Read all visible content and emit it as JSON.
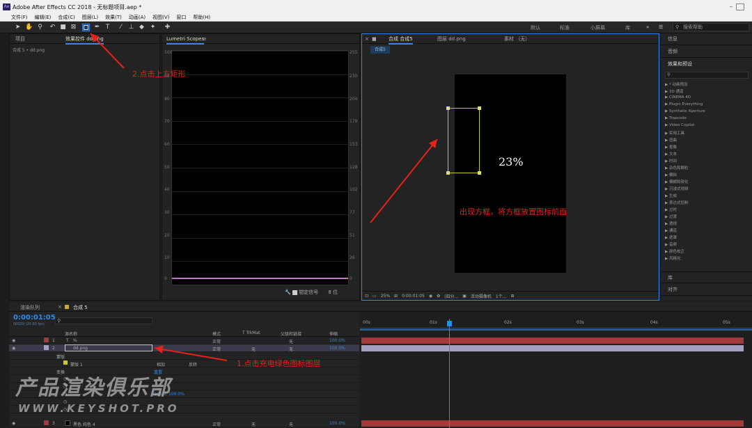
{
  "title": "Adobe After Effects CC 2018 - 无标题项目.aep *",
  "menu": [
    "文件(F)",
    "编辑(E)",
    "合成(C)",
    "图层(L)",
    "效果(T)",
    "动画(A)",
    "视图(V)",
    "窗口",
    "帮助(H)"
  ],
  "workspaces": [
    "默认",
    "标准",
    "小屏幕",
    "库"
  ],
  "search_help": "搜索帮助",
  "project": {
    "tab1": "项目",
    "tab2": "效果控件 dd.png",
    "sub": "合成 5 • dd.png"
  },
  "scopes": {
    "title": "Lumetri Scopes",
    "left_ticks": [
      "100",
      "90",
      "80",
      "70",
      "60",
      "50",
      "40",
      "30",
      "20",
      "10",
      "0"
    ],
    "right_ticks": [
      "255",
      "230",
      "204",
      "179",
      "153",
      "128",
      "102",
      "77",
      "51",
      "26",
      "0"
    ],
    "clamp": "钳定信号",
    "bits": "8 位"
  },
  "comp": {
    "tab": "合成 合成5",
    "layer_tab": "图层 dd.png",
    "footage_tab": "素材 （无）",
    "subtab": "合成5",
    "percent_text": "23%",
    "zoom": "25%",
    "time": "0:00:01:05",
    "quality": "(四分...",
    "camera": "活动摄像机",
    "views": "1个..."
  },
  "right_panel": {
    "info": "信息",
    "audio": "音频",
    "effects_title": "效果和预设",
    "effects": [
      "▶ * 动画预设",
      "▶ 3D 通道",
      "▶ CINEMA 4D",
      "▶ Plugin Everything",
      "▶ Synthetic Aperture",
      "▶ Trapcode",
      "▶ Video Copilot",
      "▶ 实用工具",
      "▶ 扭曲",
      "▶ 抠像",
      "▶ 文本",
      "▶ 时间",
      "▶ 杂色和颗粒",
      "▶ 模拟",
      "▶ 模糊和锐化",
      "▶ 沉浸式视频",
      "▶ 生成",
      "▶ 表达式控制",
      "▶ 过时",
      "▶ 过渡",
      "▶ 透视",
      "▶ 通道",
      "▶ 遮罩",
      "▶ 音频",
      "▶ 颜色校正",
      "▶ 风格化"
    ],
    "library": "库",
    "align": "对齐"
  },
  "timeline": {
    "render_queue": "渲染队列",
    "comp_tab": "合成 5",
    "timecode": "0:00:01:05",
    "frames": "00029 (25.00 fps)",
    "col_source": "源名称",
    "col_mode": "模式",
    "col_trk": "T  TrkMat",
    "col_parent": "父级和链接",
    "col_stretch": "伸缩",
    "ruler": [
      "00s",
      "01s",
      "02s",
      "03s",
      "04s",
      "05s"
    ],
    "layers": [
      {
        "num": "1",
        "name": "%",
        "mode": "正常",
        "parent": "无",
        "stretch": "100.0%"
      },
      {
        "num": "2",
        "name": "dd.png",
        "mode": "正常",
        "trk": "无",
        "parent": "无",
        "stretch": "100.0%"
      },
      {
        "num": "3",
        "name": "黑色 纯色 4",
        "mode": "正常",
        "trk": "无",
        "parent": "无",
        "stretch": "100.0%"
      }
    ],
    "mask": "蒙版",
    "mask1": "蒙版 1",
    "mask_mode": "相加",
    "mask_invert": "反转",
    "transform": "变换",
    "reset": "重置",
    "scale_val": "100.0, 100.0%"
  },
  "annotations": {
    "a1": "2.点击上方矩形",
    "a2": "出现方框，将方框放置图标前面",
    "a3": "1.点击充电绿色图标图层"
  },
  "watermark": {
    "line1": "产品渲染俱乐部",
    "line2": "WWW.KEYSHOT.PRO"
  },
  "colors": {
    "accent": "#2d8ceb",
    "annotation": "#e5221b",
    "layer_bar": "#a33a3a",
    "selected_bar": "#a59fc1"
  }
}
